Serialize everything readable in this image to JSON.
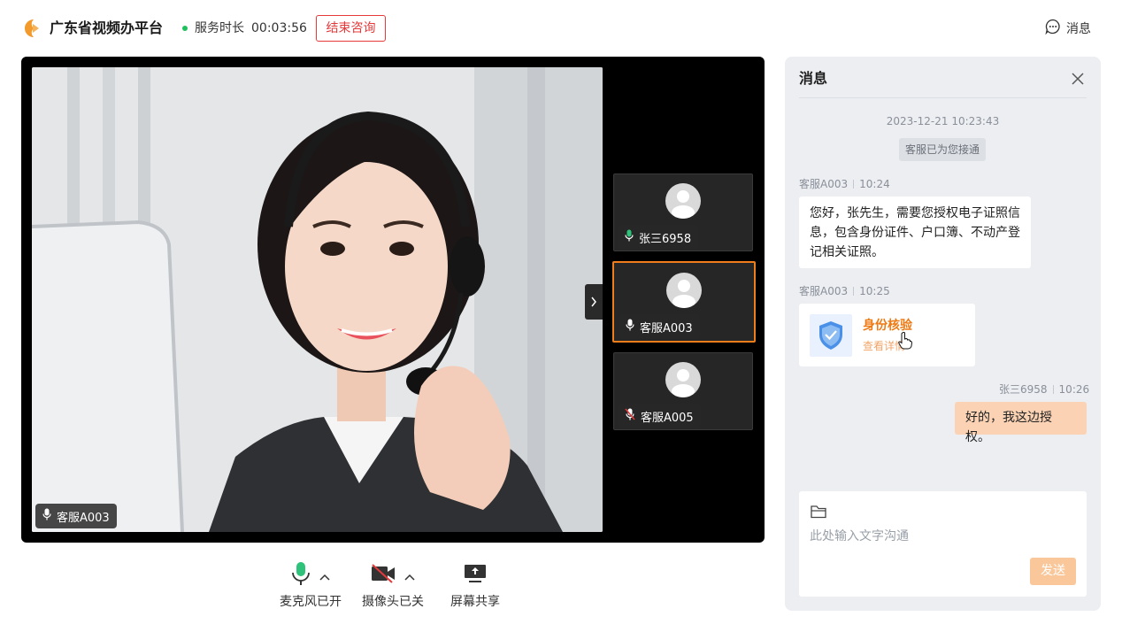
{
  "header": {
    "app_title": "广东省视频办平台",
    "service_label": "服务时长",
    "service_time": "00:03:56",
    "end_button": "结束咨询",
    "messages_link": "消息",
    "status_color": "#20c05c",
    "accent_color": "#f07d1c"
  },
  "video": {
    "main_speaker": "客服A003",
    "participants": [
      {
        "name": "张三6958",
        "mic": "on",
        "active": false
      },
      {
        "name": "客服A003",
        "mic": "on",
        "active": true
      },
      {
        "name": "客服A005",
        "mic": "muted",
        "active": false
      }
    ]
  },
  "toolbar": {
    "mic_label": "麦克风已开",
    "camera_label": "摄像头已关",
    "share_label": "屏幕共享"
  },
  "chat": {
    "title": "消息",
    "system_time": "2023-12-21 10:23:43",
    "system_note": "客服已为您接通",
    "messages": [
      {
        "sender": "客服A003",
        "time": "10:24",
        "lines": [
          "您好，张先生，需要您授权电子证照信",
          "息，包含身份证件、户口簿、不动产登",
          "记相关证照。"
        ]
      },
      {
        "sender": "客服A003",
        "time": "10:25",
        "card_title": "身份核验",
        "card_sub": "查看详情"
      },
      {
        "sender": "张三6958",
        "time": "10:26",
        "text": "好的，我这边授权。"
      }
    ],
    "input_placeholder": "此处输入文字沟通",
    "send_label": "发送"
  }
}
